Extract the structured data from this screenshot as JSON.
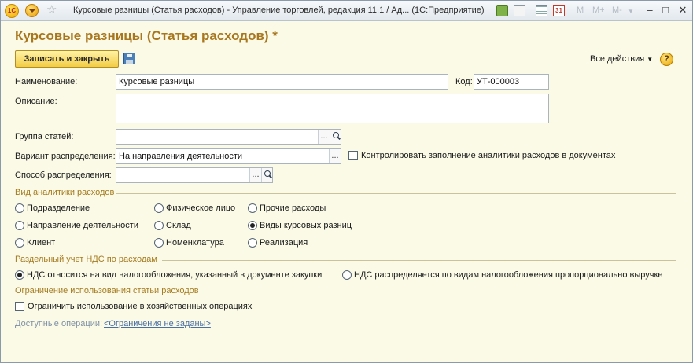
{
  "window": {
    "title": "Курсовые разницы (Статья расходов) - Управление торговлей, редакция 11.1 / Ад...  (1С:Предприятие)",
    "logo_text": "1С",
    "toolbar_m": [
      "M",
      "M+",
      "M-"
    ]
  },
  "form": {
    "title": "Курсовые разницы (Статья расходов) *",
    "save_close_label": "Записать и закрыть",
    "all_actions_label": "Все действия",
    "help_label": "?"
  },
  "fields": {
    "name_label": "Наименование:",
    "name_value": "Курсовые разницы",
    "code_label": "Код:",
    "code_value": "УТ-000003",
    "description_label": "Описание:",
    "description_value": "",
    "group_label": "Группа статей:",
    "group_value": "",
    "variant_label": "Вариант распределения:",
    "variant_value": "На направления деятельности",
    "control_analytics_label": "Контролировать заполнение аналитики расходов в документах",
    "method_label": "Способ распределения:",
    "method_value": "",
    "pick_label": "...",
    "pick_label_2": "...",
    "pick_label_3": "...",
    "pick_label_4": "..."
  },
  "analytics": {
    "section_title": "Вид аналитики расходов",
    "options": [
      {
        "label": "Подразделение",
        "selected": false
      },
      {
        "label": "Физическое лицо",
        "selected": false
      },
      {
        "label": "Прочие расходы",
        "selected": false
      },
      {
        "label": "Направление деятельности",
        "selected": false
      },
      {
        "label": "Склад",
        "selected": false
      },
      {
        "label": "Виды курсовых разниц",
        "selected": true
      },
      {
        "label": "Клиент",
        "selected": false
      },
      {
        "label": "Номенклатура",
        "selected": false
      },
      {
        "label": "Реализация",
        "selected": false
      }
    ]
  },
  "vat": {
    "section_title": "Раздельный учет НДС по расходам",
    "options": [
      {
        "label": "НДС относится на вид налогообложения, указанный в документе закупки",
        "selected": true
      },
      {
        "label": "НДС распределяется по видам налогообложения пропорционально выручке",
        "selected": false
      }
    ]
  },
  "restriction": {
    "section_title": "Ограничение использования статьи расходов",
    "checkbox_label": "Ограничить использование в хозяйственных операциях",
    "available_ops_label": "Доступные операции:",
    "available_ops_link": "<Ограничения не заданы>"
  }
}
